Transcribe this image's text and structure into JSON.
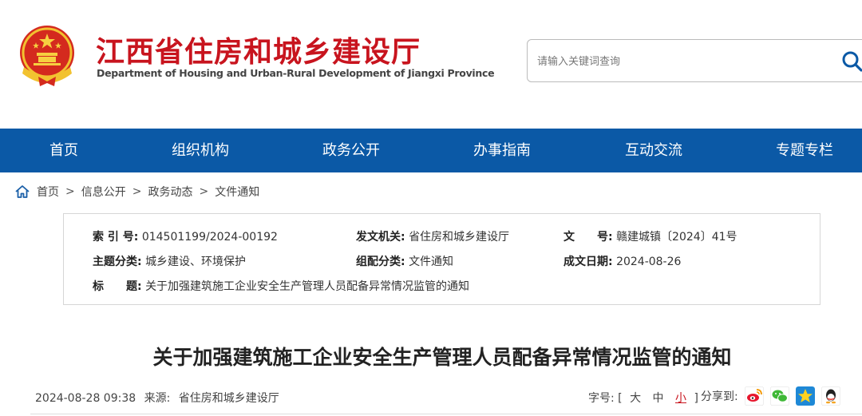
{
  "header": {
    "title": "江西省住房和城乡建设厅",
    "subtitle": "Department of Housing and Urban-Rural Development of Jiangxi Province",
    "search_placeholder": "请输入关键词查询"
  },
  "nav": {
    "items": [
      {
        "label": "首页"
      },
      {
        "label": "组织机构"
      },
      {
        "label": "政务公开"
      },
      {
        "label": "办事指南"
      },
      {
        "label": "互动交流"
      },
      {
        "label": "专题专栏"
      }
    ]
  },
  "breadcrumb": {
    "items": [
      "首页",
      "信息公开",
      "政务动态",
      "文件通知"
    ],
    "separator": ">"
  },
  "info": {
    "index_label": "索 引 号:",
    "index_value": "014501199/2024-00192",
    "issuer_label": "发文机关:",
    "issuer_value": "省住房和城乡建设厅",
    "docno_label": "文　　号:",
    "docno_value": "赣建城镇〔2024〕41号",
    "topic_label": "主题分类:",
    "topic_value": "城乡建设、环境保护",
    "category_label": "组配分类:",
    "category_value": "文件通知",
    "date_label": "成文日期:",
    "date_value": "2024-08-26",
    "title_label": "标　　题:",
    "title_value": "关于加强建筑施工企业安全生产管理人员配备异常情况监管的通知"
  },
  "article": {
    "title": "关于加强建筑施工企业安全生产管理人员配备异常情况监管的通知",
    "datetime": "2024-08-28 09:38",
    "source_label": "来源:",
    "source_value": "省住房和城乡建设厅",
    "fontsize_label": "字号:",
    "fontsize_open": "[",
    "fontsize_close": "]",
    "fontsize_options": [
      "大",
      "中",
      "小"
    ],
    "share_label": "分享到:"
  },
  "colors": {
    "brand_red": "#c8141e",
    "nav_blue": "#0b59a6"
  },
  "icons": [
    "national-emblem-icon",
    "search-icon",
    "home-icon",
    "weibo-icon",
    "wechat-icon",
    "qzone-icon",
    "qq-icon"
  ]
}
